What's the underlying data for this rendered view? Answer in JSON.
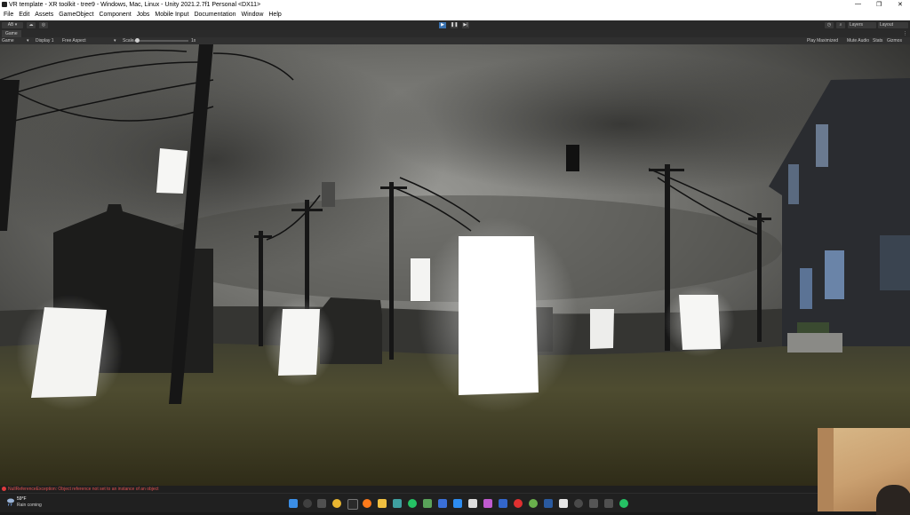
{
  "window": {
    "title": "VR template - XR toolkit - tree9 - Windows, Mac, Linux - Unity 2021.2.7f1 Personal <DX11>",
    "controls": [
      "—",
      "❐",
      "✕"
    ]
  },
  "menu": [
    "File",
    "Edit",
    "Assets",
    "GameObject",
    "Component",
    "Jobs",
    "Mobile Input",
    "Documentation",
    "Window",
    "Help"
  ],
  "toolbar": {
    "account_label": "AB ▾",
    "layers_label": "Layers",
    "layout_label": "Layout"
  },
  "game_tab": {
    "label": "Game"
  },
  "game_controls": {
    "mode": "Game",
    "display": "Display 1",
    "aspect": "Free Aspect",
    "scale_label": "Scale",
    "scale_value": "1x",
    "play_maximized": "Play Maximized",
    "mute_audio": "Mute Audio",
    "stats": "Stats",
    "gizmos": "Gizmos"
  },
  "status": {
    "message": "NullReferenceException: Object reference not set to an instance of an object"
  },
  "taskbar": {
    "temperature": "59°F",
    "weather": "Rain coming"
  },
  "colors": {
    "accent_play": "#3a72b0",
    "error": "#e03c3c",
    "editor_dark": "#282828"
  }
}
